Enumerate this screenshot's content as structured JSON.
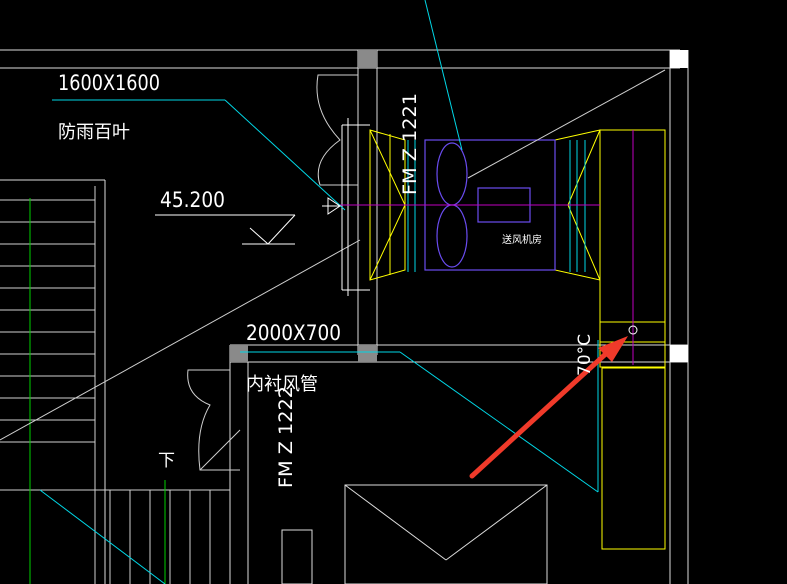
{
  "labels": {
    "dimension_louver": "1600X1600",
    "louver_name": "防雨百叶",
    "elevation": "45.200",
    "fire_damper_1": "FM Z 1221",
    "room_name": "送风机房",
    "dimension_duct": "2000X700",
    "duct_name": "内衬风管",
    "fire_damper_2": "FM Z 1222",
    "damper_temp": "70°C",
    "stair_down": "下"
  },
  "colors": {
    "background": "#000000",
    "walls": "#ffffff",
    "cyan": "#00d7e6",
    "yellow": "#ffff00",
    "purple": "#6a4cf0",
    "magenta": "#c000c0",
    "green": "#00d000",
    "arrow": "#f03a2a"
  }
}
